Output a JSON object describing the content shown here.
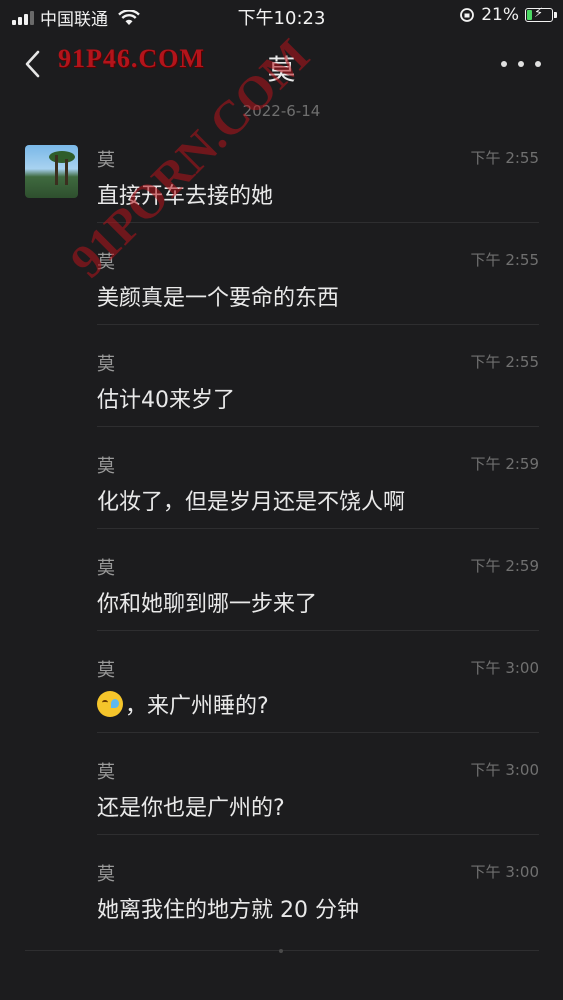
{
  "status_bar": {
    "carrier": "中国联通",
    "time": "下午10:23",
    "battery_percent": "21%",
    "battery_level": 0.21,
    "battery_color": "#4cd964"
  },
  "nav": {
    "title": "莫",
    "back_icon": "chevron-left-icon",
    "more_icon": "ellipsis-icon"
  },
  "watermark": {
    "top_text": "91P46.COM",
    "diagonal_text": "91PORN.COM"
  },
  "date_separator": "2022-6-14",
  "messages": [
    {
      "sender": "莫",
      "time": "下午 2:55",
      "text": "直接开车去接的她"
    },
    {
      "sender": "莫",
      "time": "下午 2:55",
      "text": "美颜真是一个要命的东西"
    },
    {
      "sender": "莫",
      "time": "下午 2:55",
      "text": "估计40来岁了"
    },
    {
      "sender": "莫",
      "time": "下午 2:59",
      "text": "化妆了，但是岁月还是不饶人啊"
    },
    {
      "sender": "莫",
      "time": "下午 2:59",
      "text": "你和她聊到哪一步来了"
    },
    {
      "sender": "莫",
      "time": "下午 3:00",
      "text": "，来广州睡的?",
      "emoji": "laughing-crying-emoji"
    },
    {
      "sender": "莫",
      "time": "下午 3:00",
      "text": "还是你也是广州的?"
    },
    {
      "sender": "莫",
      "time": "下午 3:00",
      "text": "她离我住的地方就 20 分钟"
    }
  ]
}
